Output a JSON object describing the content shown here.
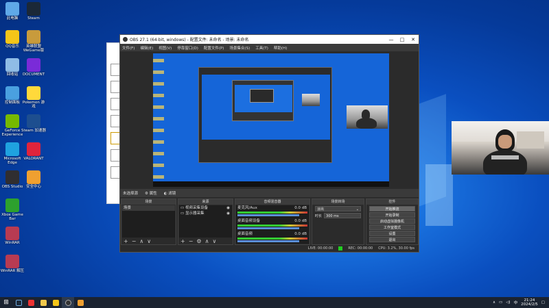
{
  "desktop": {
    "icons": [
      {
        "name": "computer-icon",
        "label": "此电脑",
        "color": "#5fa8e8"
      },
      {
        "name": "steam-icon",
        "label": "Steam",
        "color": "#1b2838"
      },
      {
        "name": "qq-icon",
        "label": "QQ音乐",
        "color": "#f5c518"
      },
      {
        "name": "game-icon",
        "label": "英雄联盟 WeGame版",
        "color": "#c89b3c"
      },
      {
        "name": "recycle-bin-icon",
        "label": "回收站",
        "color": "#8fbce6"
      },
      {
        "name": "app-icon",
        "label": "DOCUMENT",
        "color": "#7a2bd8"
      },
      {
        "name": "control-panel-icon",
        "label": "控制面板",
        "color": "#4aa0e0"
      },
      {
        "name": "pikachu-icon",
        "label": "Pokemon 游戏",
        "color": "#ffd93b"
      },
      {
        "name": "nvidia-icon",
        "label": "GeForce Experience",
        "color": "#76b900"
      },
      {
        "name": "anchor-icon",
        "label": "Steam 加速器",
        "color": "#1d4e8f"
      },
      {
        "name": "edge-icon",
        "label": "Microsoft Edge",
        "color": "#1fa2e0"
      },
      {
        "name": "valorant-icon",
        "label": "VALORANT",
        "color": "#e0243c"
      },
      {
        "name": "obs-icon",
        "label": "OBS Studio",
        "color": "#302e31"
      },
      {
        "name": "shield-icon",
        "label": "安全中心",
        "color": "#f0a030"
      },
      {
        "name": "xbox-icon",
        "label": "Xbox Game Bar",
        "color": "#2da12d"
      },
      {
        "name": "archive-icon",
        "label": "WinRAR",
        "color": "#b83b52"
      },
      {
        "name": "archive2-icon",
        "label": "WinRAR 解压",
        "color": "#b83b52"
      }
    ]
  },
  "obs": {
    "title": "OBS 27.1 (64-bit, windows) - 配置文件: 未命名 - 场景: 未命名",
    "menu": [
      "文件(F)",
      "编辑(E)",
      "视图(V)",
      "停靠窗口(D)",
      "配置文件(P)",
      "场景集合(S)",
      "工具(T)",
      "帮助(H)"
    ],
    "status_label": "未选择源",
    "status_props": "属性",
    "status_filters": "滤镜",
    "scenes_title": "场景",
    "scenes": [
      "场景"
    ],
    "sources_title": "来源",
    "sources": [
      "视频采集设备",
      "显示器采集"
    ],
    "mixer_title": "音频混音器",
    "mixer_tracks": [
      {
        "label": "麦克风/Aux",
        "db": "0.0 dB"
      },
      {
        "label": "桌面音频设备",
        "db": "0.0 dB"
      },
      {
        "label": "桌面音频",
        "db": "0.0 dB"
      }
    ],
    "transitions_title": "场景转场",
    "transition_value": "淡出",
    "duration_label": "时长",
    "duration_value": "300 ms",
    "controls_title": "控件",
    "controls": [
      "开始推流",
      "开始录制",
      "启动虚拟摄像机",
      "工作室模式",
      "设置",
      "退出"
    ],
    "bottom_status": [
      "LIVE: 00:00:00",
      "REC: 00:00:00",
      "CPU: 3.2%, 30.00 fps"
    ],
    "foot_scene": [
      "+",
      "−",
      "∧",
      "∨"
    ],
    "foot_source": [
      "+",
      "−",
      "⚙",
      "∧",
      "∨"
    ]
  },
  "taskbar": {
    "time": "21:24",
    "date": "2024/2/5"
  }
}
